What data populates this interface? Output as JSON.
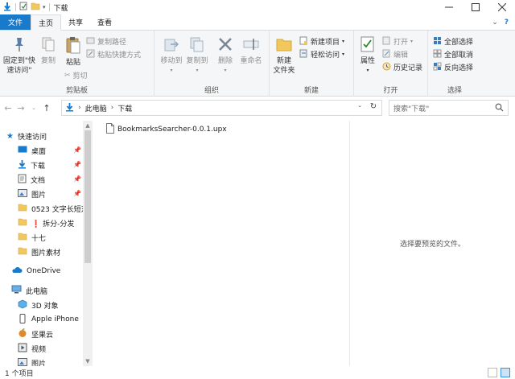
{
  "window": {
    "title": "下载",
    "controls": [
      "minimize",
      "maximize",
      "close"
    ]
  },
  "ribbon_tabs": {
    "file": "文件",
    "home": "主页",
    "share": "共享",
    "view": "查看"
  },
  "ribbon": {
    "clipboard": {
      "label": "剪贴板",
      "pin_quick_access": "固定到\"快速访问\"",
      "copy": "复制",
      "paste": "粘贴",
      "copy_path": "复制路径",
      "paste_shortcut": "粘贴快捷方式",
      "cut": "剪切"
    },
    "organize": {
      "label": "组织",
      "move_to": "移动到",
      "copy_to": "复制到",
      "delete": "删除",
      "rename": "重命名"
    },
    "new": {
      "label": "新建",
      "new_folder": "新建\n文件夹",
      "new_item": "新建项目",
      "easy_access": "轻松访问"
    },
    "open": {
      "label": "打开",
      "properties": "属性",
      "open": "打开",
      "edit": "编辑",
      "history": "历史记录"
    },
    "select": {
      "label": "选择",
      "select_all": "全部选择",
      "select_none": "全部取消",
      "invert": "反向选择"
    }
  },
  "address": {
    "crumbs": [
      "此电脑",
      "下载"
    ],
    "search_placeholder": "搜索\"下载\""
  },
  "nav_pane": {
    "quick_access": "快速访问",
    "items": [
      {
        "label": "桌面",
        "icon": "desktop-icon",
        "pinned": true
      },
      {
        "label": "下载",
        "icon": "download-icon",
        "pinned": true
      },
      {
        "label": "文档",
        "icon": "document-icon",
        "pinned": true
      },
      {
        "label": "图片",
        "icon": "pictures-icon",
        "pinned": true
      },
      {
        "label": "0523 文字长短对",
        "icon": "folder-icon",
        "pinned": false
      },
      {
        "label": "❗ 拆分-分发",
        "icon": "folder-icon",
        "pinned": false
      },
      {
        "label": "十七",
        "icon": "folder-icon",
        "pinned": false
      },
      {
        "label": "图片素材",
        "icon": "folder-icon",
        "pinned": false
      }
    ],
    "onedrive": "OneDrive",
    "this_pc": "此电脑",
    "pc_items": [
      {
        "label": "3D 对象",
        "icon": "3d-objects-icon"
      },
      {
        "label": "Apple iPhone",
        "icon": "iphone-icon"
      },
      {
        "label": "坚果云",
        "icon": "jianguoyun-icon"
      },
      {
        "label": "视频",
        "icon": "video-icon"
      },
      {
        "label": "图片",
        "icon": "pictures-icon"
      }
    ]
  },
  "content": {
    "files": [
      {
        "name": "BookmarksSearcher-0.0.1.upx",
        "icon": "file-icon"
      }
    ]
  },
  "preview": {
    "message": "选择要预览的文件。"
  },
  "statusbar": {
    "item_count": "1 个项目"
  },
  "colors": {
    "accent": "#1979ca",
    "folder": "#f2c75c"
  }
}
